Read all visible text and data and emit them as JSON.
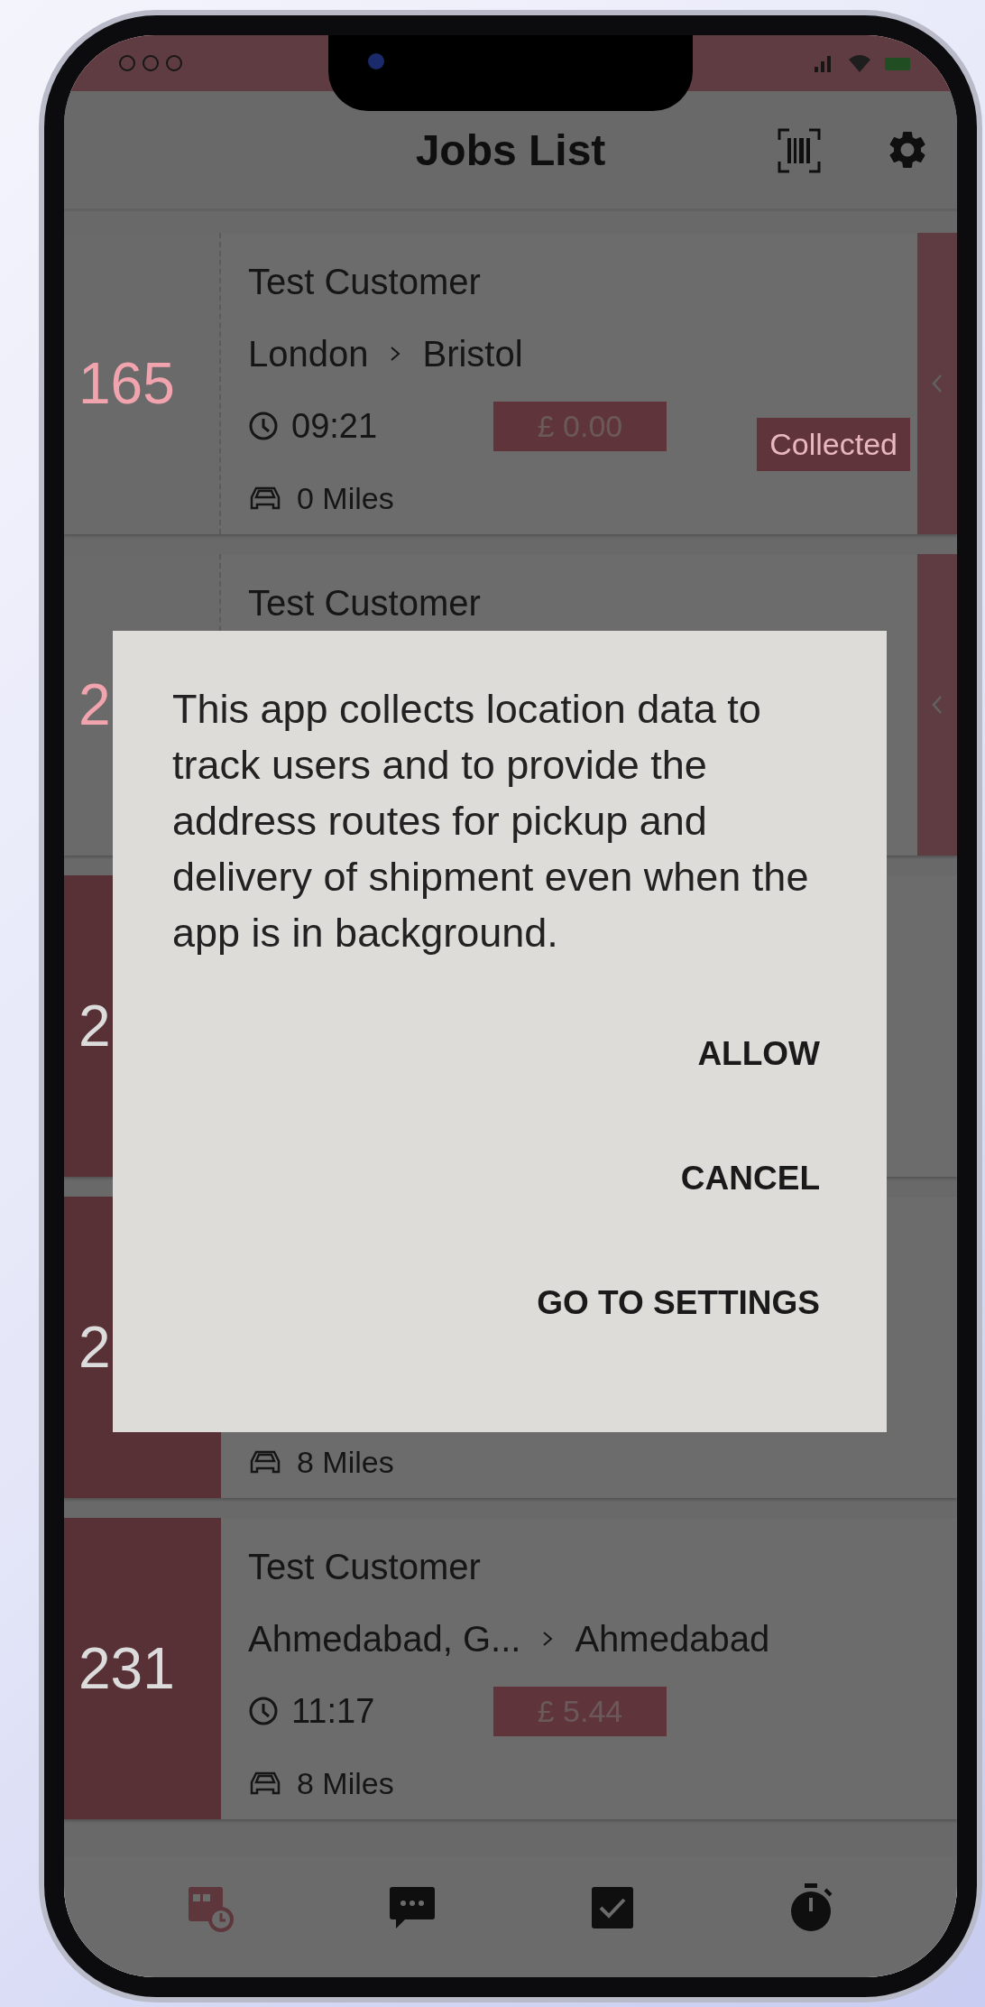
{
  "app_bar": {
    "title": "Jobs List"
  },
  "jobs": [
    {
      "number": "165",
      "highlighted": false,
      "customer": "Test Customer",
      "from": "London",
      "to": "Bristol",
      "time": "09:21",
      "price": "£ 0.00",
      "status": "Collected",
      "miles": "0 Miles"
    },
    {
      "number": "2",
      "highlighted": false,
      "customer": "Test Customer"
    },
    {
      "number": "2",
      "highlighted": true
    },
    {
      "number": "2",
      "highlighted": true,
      "miles": "8 Miles"
    },
    {
      "number": "231",
      "highlighted": true,
      "customer": "Test Customer",
      "from": "Ahmedabad, G...",
      "to": "Ahmedabad",
      "time": "11:17",
      "price": "£ 5.44",
      "miles": "8 Miles"
    }
  ],
  "dialog": {
    "message": "This app collects location data to track users and to provide the address routes for pickup and delivery of shipment even when the app is in background.",
    "buttons": [
      "ALLOW",
      "CANCEL",
      "GO TO SETTINGS"
    ]
  },
  "bottom_nav": [
    {
      "kind": "jobs",
      "selected": true
    },
    {
      "kind": "chat",
      "selected": false
    },
    {
      "kind": "done",
      "selected": false
    },
    {
      "kind": "timer",
      "selected": false
    }
  ]
}
